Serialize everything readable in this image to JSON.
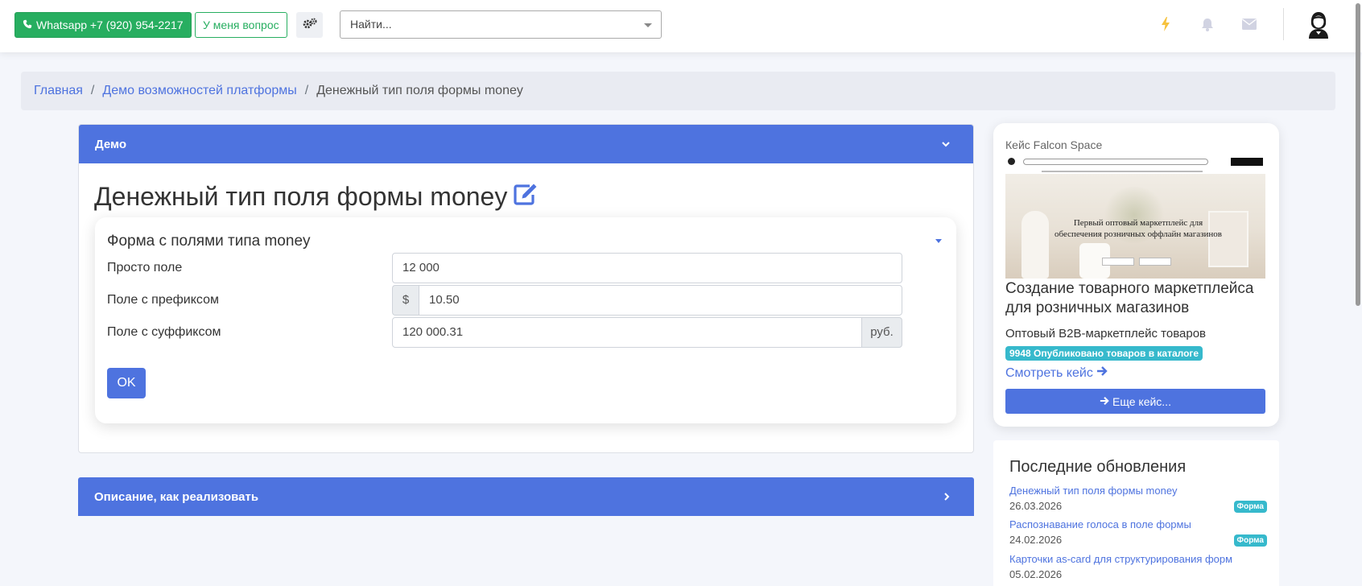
{
  "navbar": {
    "whatsapp_label": "Whatsapp +7 (920) 954-2217",
    "question_label": "У меня вопрос",
    "search_placeholder": "Найти..."
  },
  "breadcrumb": {
    "home": "Главная",
    "section": "Демо возможностей платформы",
    "current": "Денежный тип поля формы money"
  },
  "demo_card": {
    "header": "Демо",
    "title": "Денежный тип поля формы money",
    "form": {
      "title": "Форма с полями типа money",
      "fields": [
        {
          "label": "Просто поле",
          "value": "12 000"
        },
        {
          "label": "Поле с префиксом",
          "prefix": "$",
          "value": "10.50"
        },
        {
          "label": "Поле с суффиксом",
          "value": "120 000.31",
          "suffix": "руб."
        }
      ],
      "submit_label": "OK"
    }
  },
  "description_card": {
    "header": "Описание, как реализовать"
  },
  "case": {
    "label": "Кейс Falcon Space",
    "image_text": "Первый оптовый маркетплейс для обеспечения розничных оффлайн магазинов",
    "title": "Создание товарного маркетплейса для розничных магазинов",
    "subtitle": "Оптовый B2B-маркетплейс товаров",
    "badge": "9948 Опубликовано товаров в каталоге",
    "link": "Смотреть кейс",
    "more_button": "Еще кейс..."
  },
  "updates": {
    "title": "Последние обновления",
    "items": [
      {
        "title": "Денежный тип поля формы money",
        "date": "26.03.2026",
        "badge": "Форма"
      },
      {
        "title": "Распознавание голоса в поле формы",
        "date": "24.02.2026",
        "badge": "Форма"
      },
      {
        "title": "Карточки as-card для структурирования форм",
        "date": "05.02.2026",
        "badge": ""
      }
    ]
  },
  "colors": {
    "primary": "#4e73df",
    "whatsapp": "#27ae60",
    "info": "#36b9cc",
    "warning": "#f6c23e"
  },
  "icons": {
    "whatsapp": "phone-icon",
    "gears": "cogs-icon",
    "edit": "edit-icon",
    "bolt": "bolt-icon",
    "bell": "bell-icon",
    "mail": "envelope-icon",
    "avatar": "user-avatar-icon"
  }
}
